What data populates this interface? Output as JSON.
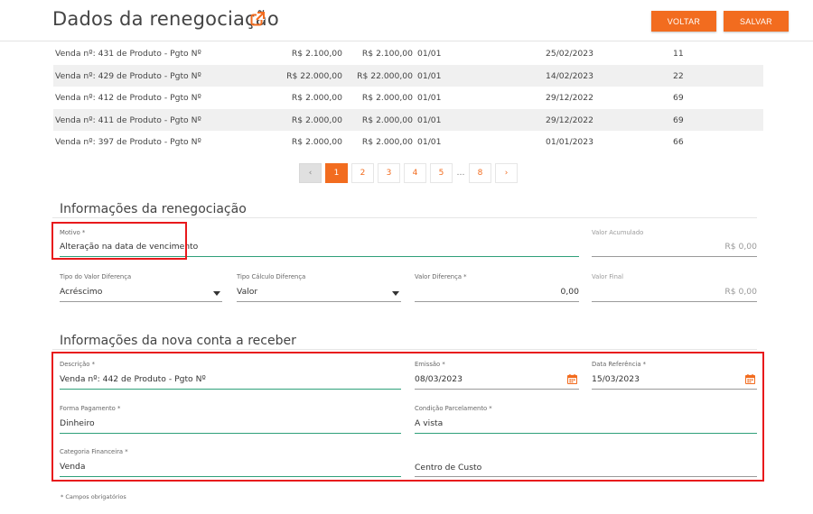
{
  "header": {
    "title": "Dados da renegociação",
    "voltar_label": "VOLTAR",
    "salvar_label": "SALVAR"
  },
  "table": {
    "rows": [
      {
        "descricao": "Venda nº: 431 de Produto - Pgto Nº",
        "valor": "R$ 2.100,00",
        "valor_atual": "R$ 2.100,00",
        "parcela": "01/01",
        "vencimento": "25/02/2023",
        "dias": "11"
      },
      {
        "descricao": "Venda nº: 429 de Produto - Pgto Nº",
        "valor": "R$ 22.000,00",
        "valor_atual": "R$ 22.000,00",
        "parcela": "01/01",
        "vencimento": "14/02/2023",
        "dias": "22"
      },
      {
        "descricao": "Venda nº: 412 de Produto - Pgto Nº",
        "valor": "R$ 2.000,00",
        "valor_atual": "R$ 2.000,00",
        "parcela": "01/01",
        "vencimento": "29/12/2022",
        "dias": "69"
      },
      {
        "descricao": "Venda nº: 411 de Produto - Pgto Nº",
        "valor": "R$ 2.000,00",
        "valor_atual": "R$ 2.000,00",
        "parcela": "01/01",
        "vencimento": "29/12/2022",
        "dias": "69"
      },
      {
        "descricao": "Venda nº: 397 de Produto - Pgto Nº",
        "valor": "R$ 2.000,00",
        "valor_atual": "R$ 2.000,00",
        "parcela": "01/01",
        "vencimento": "01/01/2023",
        "dias": "66"
      }
    ]
  },
  "pagination": {
    "prev": "‹",
    "pages": [
      "1",
      "2",
      "3",
      "4",
      "5"
    ],
    "ellipsis": "…",
    "last": "8",
    "next": "›",
    "current": "1"
  },
  "renegociacao": {
    "section_title": "Informações da renegociação",
    "motivo": {
      "label": "Motivo *",
      "value": "Alteração na data de vencimento"
    },
    "valor_acumulado": {
      "label": "Valor Acumulado",
      "value": "R$ 0,00"
    },
    "tipo_valor_diferenca": {
      "label": "Tipo do Valor Diferença",
      "value": "Acréscimo"
    },
    "tipo_calculo_diferenca": {
      "label": "Tipo Cálculo Diferença",
      "value": "Valor"
    },
    "valor_diferenca": {
      "label": "Valor Diferença *",
      "value": "0,00"
    },
    "valor_final": {
      "label": "Valor Final",
      "value": "R$ 0,00"
    }
  },
  "nova_conta": {
    "section_title": "Informações da nova conta a receber",
    "descricao": {
      "label": "Descrição *",
      "value": "Venda nº: 442 de Produto - Pgto Nº"
    },
    "emissao": {
      "label": "Emissão *",
      "value": "08/03/2023"
    },
    "data_referencia": {
      "label": "Data Referência *",
      "value": "15/03/2023"
    },
    "forma_pagamento": {
      "label": "Forma Pagamento *",
      "value": "Dinheiro"
    },
    "condicao_parcelamento": {
      "label": "Condição Parcelamento *",
      "value": "A vista"
    },
    "categoria_financeira": {
      "label": "Categoria Financeira *",
      "value": "Venda"
    },
    "centro_custo": {
      "label": "",
      "placeholder": "Centro de Custo"
    }
  },
  "footnote": "* Campos obrigatórios",
  "colors": {
    "accent": "#f26c1f",
    "field_line": "#2fa07a",
    "highlight_box": "#e8191c"
  },
  "icons": {
    "title_link": "external-link-icon",
    "date": "calendar-icon",
    "select": "caret-down-icon"
  }
}
